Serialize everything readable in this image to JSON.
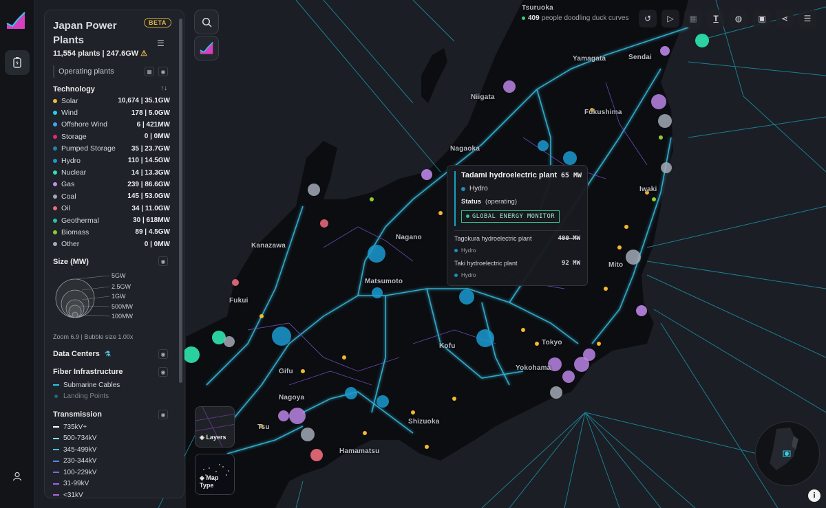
{
  "app": {
    "title": "Japan Power Plants",
    "badge": "BETA",
    "summary": "11,554 plants | 247.6GW",
    "warning_icon": "warning-icon",
    "operating_label": "Operating plants"
  },
  "technology": {
    "title": "Technology",
    "items": [
      {
        "name": "Solar",
        "value": "10,674 | 35.1GW",
        "color": "#f5b82e"
      },
      {
        "name": "Wind",
        "value": "178 | 5.0GW",
        "color": "#20d4f0"
      },
      {
        "name": "Offshore Wind",
        "value": "6 | 421MW",
        "color": "#3aa7ff"
      },
      {
        "name": "Storage",
        "value": "0 | 0MW",
        "color": "#e8247f"
      },
      {
        "name": "Pumped Storage",
        "value": "35 | 23.7GW",
        "color": "#1f86a8"
      },
      {
        "name": "Hydro",
        "value": "110 | 14.5GW",
        "color": "#1b9ad0"
      },
      {
        "name": "Nuclear",
        "value": "14 | 13.3GW",
        "color": "#2ee6b0"
      },
      {
        "name": "Gas",
        "value": "239 | 86.6GW",
        "color": "#c58cf2"
      },
      {
        "name": "Coal",
        "value": "145 | 53.0GW",
        "color": "#a3aab6"
      },
      {
        "name": "Oil",
        "value": "34 | 11.0GW",
        "color": "#f06b7c"
      },
      {
        "name": "Geothermal",
        "value": "30 | 618MW",
        "color": "#1fc7a8"
      },
      {
        "name": "Biomass",
        "value": "89 | 4.5GW",
        "color": "#8ccf2c"
      },
      {
        "name": "Other",
        "value": "0 | 0MW",
        "color": "#a7acb7"
      }
    ]
  },
  "size": {
    "title": "Size (MW)",
    "labels": [
      "5GW",
      "2.5GW",
      "1GW",
      "500MW",
      "100MW"
    ]
  },
  "zoom_text": "Zoom 6.9 | Bubble size 1.00x",
  "data_centers": {
    "title": "Data Centers"
  },
  "fiber": {
    "title": "Fiber Infrastructure",
    "items": [
      {
        "label": "Submarine Cables",
        "color": "#23c9e6",
        "dim": false
      },
      {
        "label": "Landing Points",
        "color": "#1e6b80",
        "dim": true
      }
    ]
  },
  "transmission": {
    "title": "Transmission",
    "items": [
      {
        "label": "735kV+",
        "color": "#ffffff"
      },
      {
        "label": "500-734kV",
        "color": "#7fe9ff"
      },
      {
        "label": "345-499kV",
        "color": "#39c7ee"
      },
      {
        "label": "230-344kV",
        "color": "#4a8ef0"
      },
      {
        "label": "100-229kV",
        "color": "#6f6ff0"
      },
      {
        "label": "31-99kV",
        "color": "#9a66e8"
      },
      {
        "label": "<31kV",
        "color": "#b06ad8"
      }
    ]
  },
  "map_buttons": {
    "layers": "Layers",
    "map_type": "Map Type"
  },
  "counter": {
    "count": "409",
    "text": "people doodling duck curves"
  },
  "tooltip": {
    "name": "Tadami hydroelectric plant",
    "mw": "65 MW",
    "tech": "Hydro",
    "status_label": "Status",
    "status_value": "(operating)",
    "source": "GLOBAL ENERGY MONITOR",
    "others": [
      {
        "name": "Tagokura hydroelectric plant",
        "mw": "400 MW",
        "tech": "Hydro"
      },
      {
        "name": "Taki hydroelectric plant",
        "mw": "92 MW",
        "tech": "Hydro"
      }
    ]
  },
  "cities": [
    "Tsuruoka",
    "Yamagata",
    "Sendai",
    "Niigata",
    "Fukushima",
    "Nagaoka",
    "Iwaki",
    "Nagano",
    "Kanazawa",
    "Mito",
    "Matsumoto",
    "Fukui",
    "Kofu",
    "Tokyo",
    "Yokohama",
    "Gifu",
    "Nagoya",
    "Shizuoka",
    "Tsu",
    "Hamamatsu"
  ]
}
